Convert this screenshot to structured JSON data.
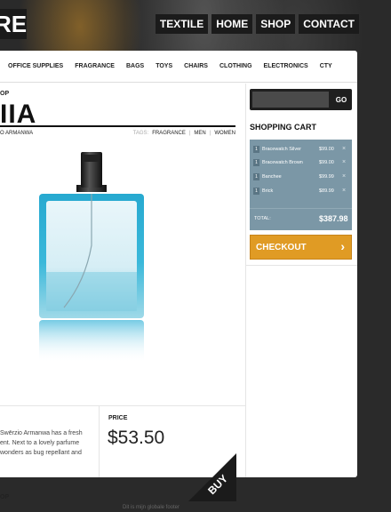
{
  "header": {
    "logo_text": "RE",
    "nav": [
      "TEXTILE",
      "HOME",
      "SHOP",
      "CONTACT"
    ]
  },
  "categories": [
    "OFFICE SUPPLIES",
    "FRAGRANCE",
    "BAGS",
    "TOYS",
    "CHAIRS",
    "CLOTHING",
    "ELECTRONICS",
    "CTY"
  ],
  "product": {
    "breadcrumb": "OP",
    "title": "IIA",
    "subtitle": "O ARMANWA",
    "tags_label": "TAGS:",
    "tags": [
      "FRAGRANCE",
      "MEN",
      "WOMEN"
    ],
    "tag_separator": "|",
    "description": "Swērzio Armanwa has a fresh ent. Next to a lovely parfume wonders as bug repellant and",
    "bottom_crumb": "OP",
    "price_label": "PRICE",
    "price": "$53.50",
    "buy_label": "BUY"
  },
  "sidebar": {
    "search_placeholder": "",
    "search_button": "GO",
    "cart_title": "SHOPPING CART",
    "cart_items": [
      {
        "qty": "1",
        "name": "Bracewatch Silver",
        "price": "$99.00",
        "remove": "×"
      },
      {
        "qty": "1",
        "name": "Bracewatch Brown",
        "price": "$99.00",
        "remove": "×"
      },
      {
        "qty": "1",
        "name": "Banchee",
        "price": "$99.99",
        "remove": "×"
      },
      {
        "qty": "1",
        "name": "Brick",
        "price": "$89.99",
        "remove": "×"
      }
    ],
    "total_label": "TOTAL:",
    "total_value": "$387.98",
    "checkout_label": "CHECKOUT",
    "checkout_chevron": "›"
  },
  "footer": {
    "text": "Dit is mijn globale footer"
  },
  "colors": {
    "accent": "#e09b24",
    "cart_bg": "#7b97a6",
    "bottle_blue": "#2ab4d8"
  }
}
